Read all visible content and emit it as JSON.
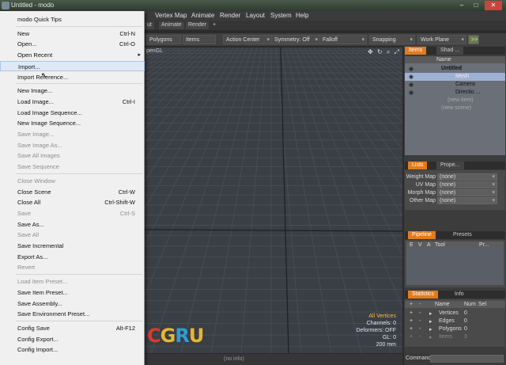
{
  "window": {
    "title": "Untitled - modo",
    "min": "–",
    "max": "□",
    "close": "✕"
  },
  "menubar": [
    "Vertex Map",
    "Animate",
    "Render",
    "Layout",
    "System",
    "Help"
  ],
  "layout_tabs": [
    "Animate",
    "Render",
    "+"
  ],
  "layout_tab_partial": "ut",
  "toolbar": {
    "polygons": "Polygons",
    "items": "Items",
    "action_center": "Action Center",
    "symmetry": "Symmetry: Off",
    "falloff": "Falloff",
    "snapping": "Snapping",
    "work_plane": "Work Plane",
    "more": ">>"
  },
  "viewport": {
    "label": "penGL",
    "icons": [
      "move-icon",
      "rotate-icon",
      "zoom-icon",
      "maximize-icon"
    ],
    "icon_glyphs": [
      "✥",
      "↻",
      "⌕",
      "⤢"
    ],
    "info": {
      "selection": "All Vertices",
      "channels": "Channels: 0",
      "deformers": "Deformers: OFF",
      "gl": "GL: 0",
      "size": "200 mm"
    },
    "logo": {
      "c": "C",
      "g": "G",
      "r": "R",
      "u": "U"
    }
  },
  "status_text": "(no info)",
  "items_panel": {
    "tabs": [
      "Items",
      "Shad ..."
    ],
    "column_name": "Name",
    "rows": [
      {
        "label": "Untitled",
        "bold": true
      },
      {
        "label": "Mesh",
        "selected": true
      },
      {
        "label": "Camera"
      },
      {
        "label": "Directio ..."
      },
      {
        "label": "(new item)",
        "dim": true
      },
      {
        "label": "(new scene)",
        "dim": true
      }
    ]
  },
  "lists_panel": {
    "tabs": [
      "Lists",
      "Prope..."
    ],
    "maps": [
      {
        "label": "Weight Map",
        "value": "(none)"
      },
      {
        "label": "UV Map",
        "value": "(none)"
      },
      {
        "label": "Morph Map",
        "value": "(none)"
      },
      {
        "label": "Other Map",
        "value": "(none)"
      }
    ]
  },
  "pipeline_panel": {
    "tabs": [
      "Pipeline",
      "Presets"
    ],
    "columns": [
      "E",
      "V",
      "A",
      "Tool",
      "Pr..."
    ]
  },
  "stats_panel": {
    "tabs": [
      "Statistics",
      "Info"
    ],
    "columns": [
      "Name",
      "Num",
      "Sel"
    ],
    "rows": [
      {
        "name": "Vertices",
        "num": "0"
      },
      {
        "name": "Edges",
        "num": "0"
      },
      {
        "name": "Polygons",
        "num": "0"
      },
      {
        "name": "Items",
        "num": "3",
        "dim": true
      }
    ]
  },
  "command": {
    "label": "Command"
  },
  "file_menu": {
    "items": [
      {
        "label": "modo Quick Tips",
        "shortcut": ""
      },
      {
        "sep": true
      },
      {
        "label": "New",
        "shortcut": "Ctrl-N"
      },
      {
        "label": "Open...",
        "shortcut": "Ctrl-O"
      },
      {
        "label": "Open Recent",
        "shortcut": "",
        "submenu": true
      },
      {
        "label": "Import...",
        "shortcut": "",
        "hover": true
      },
      {
        "label": "Import Reference...",
        "shortcut": ""
      },
      {
        "sep": true
      },
      {
        "label": "New Image...",
        "shortcut": ""
      },
      {
        "label": "Load Image...",
        "shortcut": "Ctrl-I"
      },
      {
        "label": "Load Image Sequence...",
        "shortcut": ""
      },
      {
        "label": "New Image Sequence...",
        "shortcut": ""
      },
      {
        "label": "Save Image...",
        "shortcut": "",
        "disabled": true
      },
      {
        "label": "Save Image As...",
        "shortcut": "",
        "disabled": true
      },
      {
        "label": "Save All Images",
        "shortcut": "",
        "disabled": true
      },
      {
        "label": "Save Sequence",
        "shortcut": "",
        "disabled": true
      },
      {
        "sep": true
      },
      {
        "label": "Close Window",
        "shortcut": "",
        "disabled": true
      },
      {
        "label": "Close Scene",
        "shortcut": "Ctrl-W"
      },
      {
        "label": "Close All",
        "shortcut": "Ctrl-Shift-W"
      },
      {
        "label": "Save",
        "shortcut": "Ctrl-S",
        "disabled": true
      },
      {
        "label": "Save As...",
        "shortcut": ""
      },
      {
        "label": "Save All",
        "shortcut": "",
        "disabled": true
      },
      {
        "label": "Save Incremental",
        "shortcut": ""
      },
      {
        "label": "Export As...",
        "shortcut": ""
      },
      {
        "label": "Revert",
        "shortcut": "",
        "disabled": true
      },
      {
        "sep": true
      },
      {
        "label": "Load Item Preset...",
        "shortcut": "",
        "disabled": true
      },
      {
        "label": "Save Item Preset...",
        "shortcut": ""
      },
      {
        "label": "Save Assembly...",
        "shortcut": ""
      },
      {
        "label": "Save Environment Preset...",
        "shortcut": ""
      },
      {
        "sep": true
      },
      {
        "label": "Config Save",
        "shortcut": "Alt-F12"
      },
      {
        "label": "Config Export...",
        "shortcut": ""
      },
      {
        "label": "Config Import...",
        "shortcut": ""
      }
    ]
  }
}
